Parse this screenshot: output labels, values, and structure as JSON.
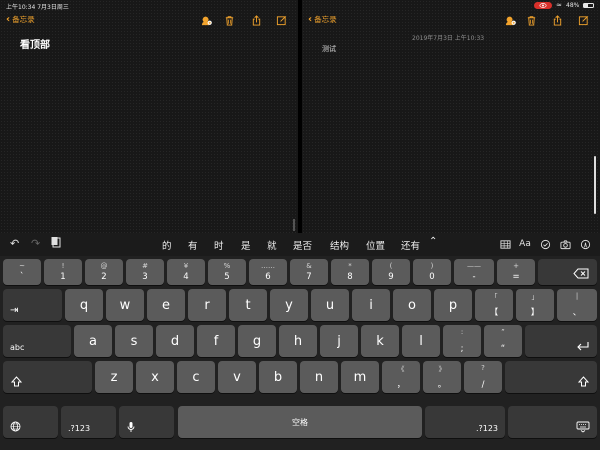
{
  "status_bar": {
    "left": "上午10:34  7月3日周三",
    "battery": "48%"
  },
  "left_pane": {
    "back_label": "备忘录",
    "note_title": "看顶部"
  },
  "right_pane": {
    "back_label": "备忘录",
    "note_date": "2019年7月3日 上午10:33",
    "note_body": "测试"
  },
  "suggestions": [
    "的",
    "有",
    "时",
    "是",
    "就",
    "是否",
    "结构",
    "位置",
    "还有"
  ],
  "keyboard": {
    "number_row": [
      {
        "top": "~",
        "bottom": "`"
      },
      {
        "top": "!",
        "bottom": "1"
      },
      {
        "top": "@",
        "bottom": "2"
      },
      {
        "top": "#",
        "bottom": "3"
      },
      {
        "top": "¥",
        "bottom": "4"
      },
      {
        "top": "%",
        "bottom": "5"
      },
      {
        "top": "……",
        "bottom": "6"
      },
      {
        "top": "&",
        "bottom": "7"
      },
      {
        "top": "*",
        "bottom": "8"
      },
      {
        "top": "(",
        "bottom": "9"
      },
      {
        "top": ")",
        "bottom": "0"
      },
      {
        "top": "——",
        "bottom": "-"
      },
      {
        "top": "+",
        "bottom": "="
      }
    ],
    "row2": [
      "q",
      "w",
      "e",
      "r",
      "t",
      "y",
      "u",
      "i",
      "o",
      "p"
    ],
    "row2_punct": [
      {
        "top": "「",
        "bottom": "【"
      },
      {
        "top": "」",
        "bottom": "】"
      },
      {
        "top": "|",
        "bottom": "、"
      }
    ],
    "row3": [
      "a",
      "s",
      "d",
      "f",
      "g",
      "h",
      "j",
      "k",
      "l"
    ],
    "row3_punct": [
      {
        "top": ":",
        "bottom": ";"
      },
      {
        "top": "”",
        "bottom": "“"
      }
    ],
    "row4": [
      "z",
      "x",
      "c",
      "v",
      "b",
      "n",
      "m"
    ],
    "row4_punct": [
      {
        "top": "《",
        "bottom": "，"
      },
      {
        "top": "》",
        "bottom": "。"
      },
      {
        "top": "?",
        "bottom": "/"
      }
    ],
    "abc_label": "abc",
    "num_switch_label": ".?123",
    "space_label": "空格"
  }
}
